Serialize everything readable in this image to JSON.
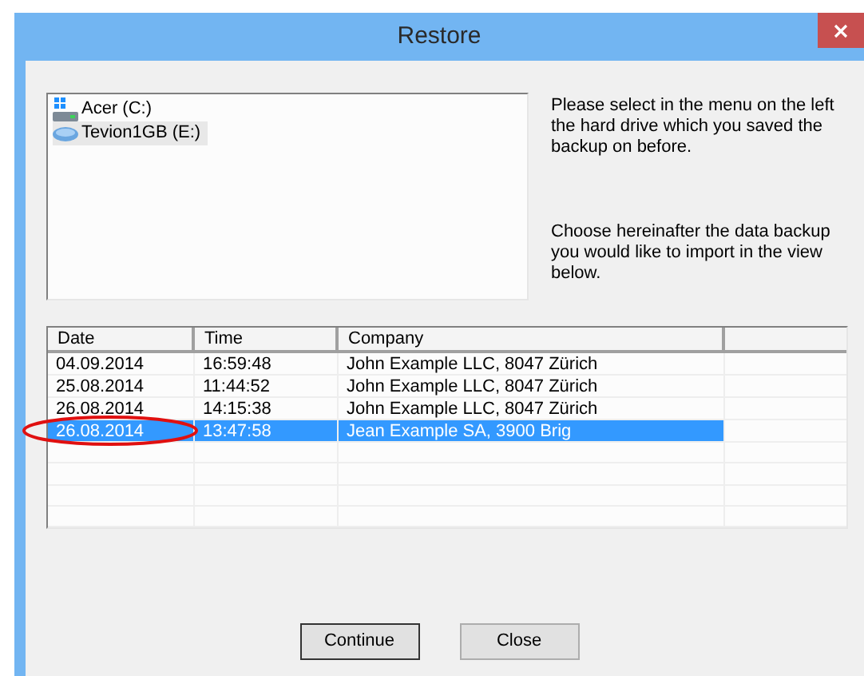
{
  "window": {
    "title": "Restore"
  },
  "drives": [
    {
      "label": "Acer (C:)",
      "kind": "system",
      "selected": false
    },
    {
      "label": "Tevion1GB (E:)",
      "kind": "removable",
      "selected": true
    }
  ],
  "instructions": [
    "Please select in the menu on the left the hard drive which you saved the backup on before.",
    "Choose hereinafter the data backup you would like to import in the view below."
  ],
  "table": {
    "columns": [
      "Date",
      "Time",
      "Company"
    ],
    "rows": [
      {
        "cells": [
          "04.09.2014",
          "16:59:48",
          "John Example LLC, 8047 Zürich"
        ],
        "selected": false
      },
      {
        "cells": [
          "25.08.2014",
          "11:44:52",
          "John Example LLC, 8047 Zürich"
        ],
        "selected": false
      },
      {
        "cells": [
          "26.08.2014",
          "14:15:38",
          "John Example LLC, 8047 Zürich"
        ],
        "selected": false
      },
      {
        "cells": [
          "26.08.2014",
          "13:47:58",
          "Jean Example SA, 3900 Brig"
        ],
        "selected": true
      }
    ]
  },
  "buttons": [
    "Continue",
    "Close"
  ]
}
